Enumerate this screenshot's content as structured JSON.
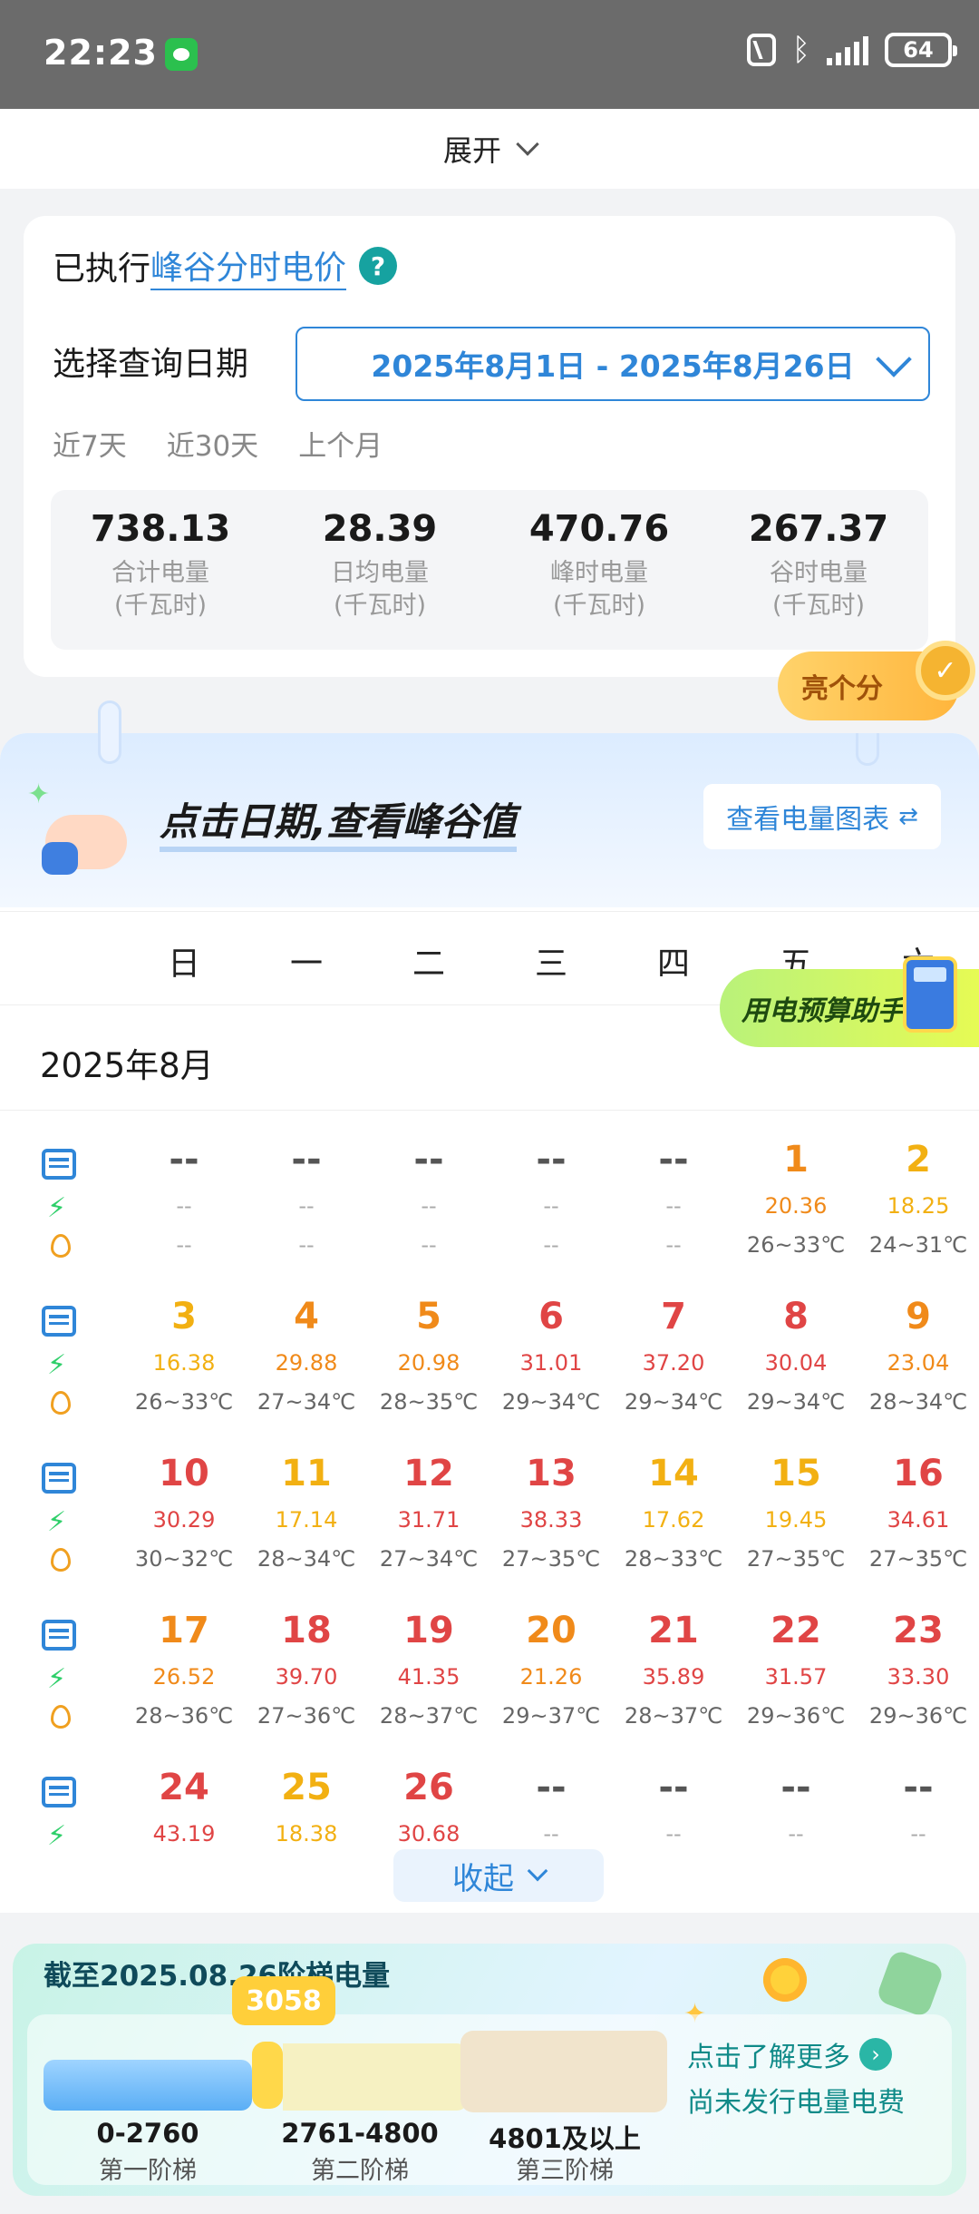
{
  "status_bar": {
    "time": "22:23",
    "battery": "64"
  },
  "expand": {
    "label": "展开"
  },
  "plan": {
    "prefix": "已执行",
    "link": "峰谷分时电价",
    "help": "?"
  },
  "query": {
    "label": "选择查询日期",
    "range": "2025年8月1日 - 2025年8月26日",
    "quick": [
      "近7天",
      "近30天",
      "上个月"
    ]
  },
  "summary": [
    {
      "value": "738.13",
      "label": "合计电量",
      "unit": "(千瓦时)"
    },
    {
      "value": "28.39",
      "label": "日均电量",
      "unit": "(千瓦时)"
    },
    {
      "value": "470.76",
      "label": "峰时电量",
      "unit": "(千瓦时)"
    },
    {
      "value": "267.37",
      "label": "谷时电量",
      "unit": "(千瓦时)"
    }
  ],
  "promo": {
    "label": "亮个分"
  },
  "hint": {
    "text": "点击日期,查看峰谷值",
    "chart_button": "查看电量图表"
  },
  "weekdays": [
    "日",
    "一",
    "二",
    "三",
    "四",
    "五",
    "六"
  ],
  "budget": {
    "label": "用电预算助手"
  },
  "month": "2025年8月",
  "weeks": [
    [
      {
        "day": "--",
        "kwh": "--",
        "temp": "--",
        "c": ""
      },
      {
        "day": "--",
        "kwh": "--",
        "temp": "--",
        "c": ""
      },
      {
        "day": "--",
        "kwh": "--",
        "temp": "--",
        "c": ""
      },
      {
        "day": "--",
        "kwh": "--",
        "temp": "--",
        "c": ""
      },
      {
        "day": "--",
        "kwh": "--",
        "temp": "--",
        "c": ""
      },
      {
        "day": "1",
        "kwh": "20.36",
        "temp": "26~33℃",
        "c": "org"
      },
      {
        "day": "2",
        "kwh": "18.25",
        "temp": "24~31℃",
        "c": "yel"
      }
    ],
    [
      {
        "day": "3",
        "kwh": "16.38",
        "temp": "26~33℃",
        "c": "yel"
      },
      {
        "day": "4",
        "kwh": "29.88",
        "temp": "27~34℃",
        "c": "org"
      },
      {
        "day": "5",
        "kwh": "20.98",
        "temp": "28~35℃",
        "c": "org"
      },
      {
        "day": "6",
        "kwh": "31.01",
        "temp": "29~34℃",
        "c": "red"
      },
      {
        "day": "7",
        "kwh": "37.20",
        "temp": "29~34℃",
        "c": "red"
      },
      {
        "day": "8",
        "kwh": "30.04",
        "temp": "29~34℃",
        "c": "red"
      },
      {
        "day": "9",
        "kwh": "23.04",
        "temp": "28~34℃",
        "c": "org"
      }
    ],
    [
      {
        "day": "10",
        "kwh": "30.29",
        "temp": "30~32℃",
        "c": "red"
      },
      {
        "day": "11",
        "kwh": "17.14",
        "temp": "28~34℃",
        "c": "yel"
      },
      {
        "day": "12",
        "kwh": "31.71",
        "temp": "27~34℃",
        "c": "red"
      },
      {
        "day": "13",
        "kwh": "38.33",
        "temp": "27~35℃",
        "c": "red"
      },
      {
        "day": "14",
        "kwh": "17.62",
        "temp": "28~33℃",
        "c": "yel"
      },
      {
        "day": "15",
        "kwh": "19.45",
        "temp": "27~35℃",
        "c": "yel"
      },
      {
        "day": "16",
        "kwh": "34.61",
        "temp": "27~35℃",
        "c": "red"
      }
    ],
    [
      {
        "day": "17",
        "kwh": "26.52",
        "temp": "28~36℃",
        "c": "org"
      },
      {
        "day": "18",
        "kwh": "39.70",
        "temp": "27~36℃",
        "c": "red"
      },
      {
        "day": "19",
        "kwh": "41.35",
        "temp": "28~37℃",
        "c": "red"
      },
      {
        "day": "20",
        "kwh": "21.26",
        "temp": "29~37℃",
        "c": "org"
      },
      {
        "day": "21",
        "kwh": "35.89",
        "temp": "28~37℃",
        "c": "red"
      },
      {
        "day": "22",
        "kwh": "31.57",
        "temp": "29~36℃",
        "c": "red"
      },
      {
        "day": "23",
        "kwh": "33.30",
        "temp": "29~36℃",
        "c": "red"
      }
    ],
    [
      {
        "day": "24",
        "kwh": "43.19",
        "temp": "",
        "c": "red"
      },
      {
        "day": "25",
        "kwh": "18.38",
        "temp": "",
        "c": "yel"
      },
      {
        "day": "26",
        "kwh": "30.68",
        "temp": "",
        "c": "red"
      },
      {
        "day": "--",
        "kwh": "--",
        "temp": "",
        "c": ""
      },
      {
        "day": "--",
        "kwh": "--",
        "temp": "",
        "c": ""
      },
      {
        "day": "--",
        "kwh": "--",
        "temp": "",
        "c": ""
      },
      {
        "day": "--",
        "kwh": "--",
        "temp": "",
        "c": ""
      }
    ]
  ],
  "collapse": {
    "label": "收起"
  },
  "tier": {
    "title": "截至2025.08.26阶梯电量",
    "current": "3058",
    "ranges": [
      {
        "range": "0-2760",
        "name": "第一阶梯"
      },
      {
        "range": "2761-4800",
        "name": "第二阶梯"
      },
      {
        "range": "4801及以上",
        "name": "第三阶梯"
      }
    ],
    "learn_more": "点击了解更多",
    "unissued": "尚未发行电量电费"
  },
  "colors": {
    "accent": "#2f86d8",
    "high": "#e04545",
    "mid": "#f08a1a",
    "low": "#f2b012"
  }
}
